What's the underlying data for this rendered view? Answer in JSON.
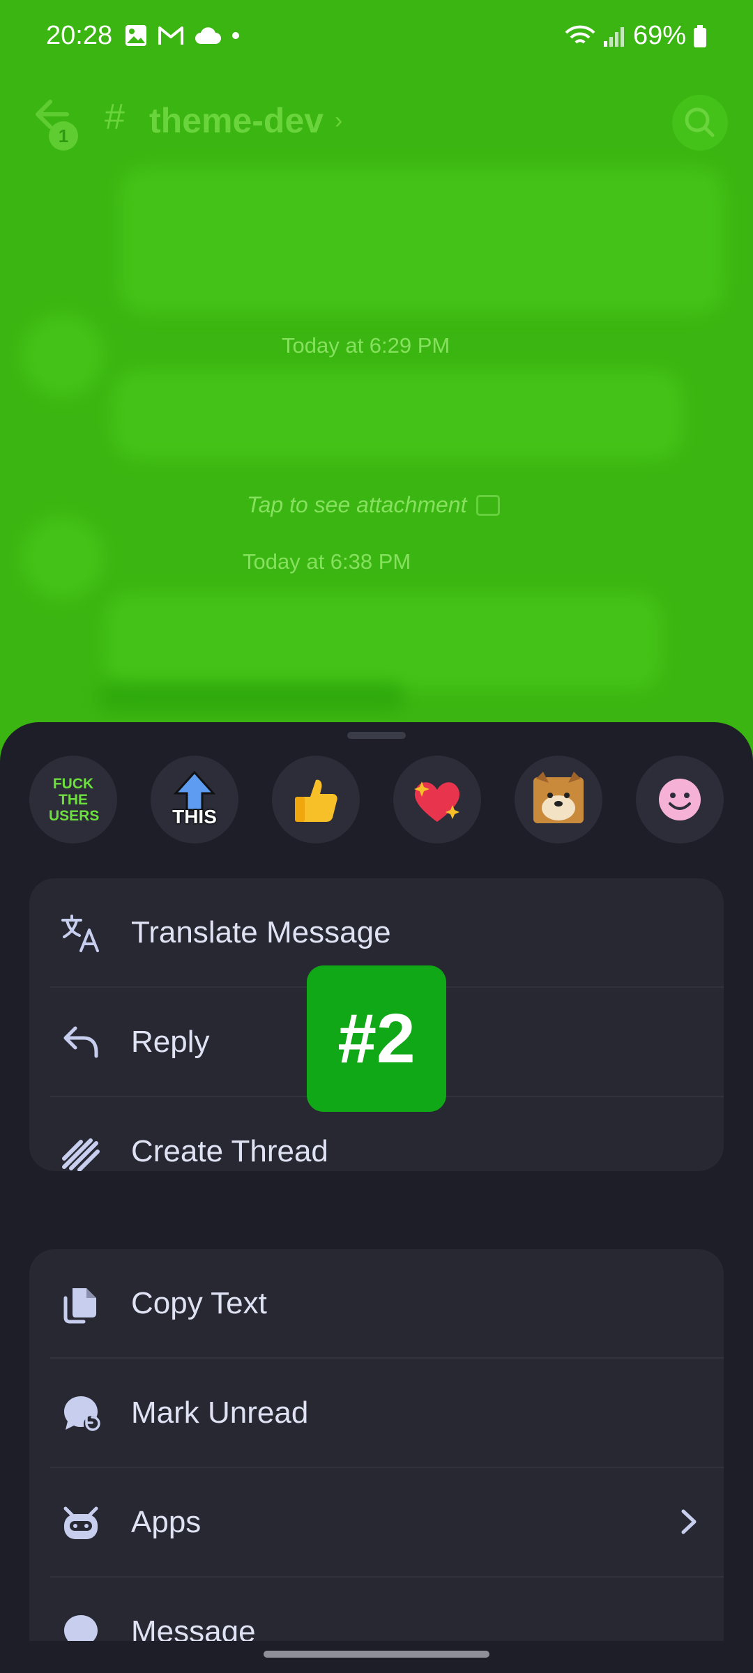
{
  "status_bar": {
    "time": "20:28",
    "battery": "69%"
  },
  "header": {
    "channel_name": "theme-dev",
    "notification_count": "1"
  },
  "chat": {
    "timestamp_1": "Today at 6:29 PM",
    "attachment_text": "Tap to see attachment",
    "timestamp_2": "Today at 6:38 PM"
  },
  "reactions": [
    {
      "name": "fuck-the-users-emoji",
      "text": "FUCK THE USERS"
    },
    {
      "name": "this-arrow-emoji",
      "text": "THIS"
    },
    {
      "name": "thumbs-up-emoji"
    },
    {
      "name": "sparkling-heart-emoji"
    },
    {
      "name": "doge-emoji"
    },
    {
      "name": "add-reaction-emoji"
    }
  ],
  "menu_primary": [
    {
      "label": "Translate Message",
      "icon": "translate-icon"
    },
    {
      "label": "Reply",
      "icon": "reply-icon"
    },
    {
      "label": "Create Thread",
      "icon": "thread-icon"
    }
  ],
  "menu_secondary": [
    {
      "label": "Copy Text",
      "icon": "copy-icon"
    },
    {
      "label": "Mark Unread",
      "icon": "mark-unread-icon"
    },
    {
      "label": "Apps",
      "icon": "apps-icon"
    },
    {
      "label": "Message",
      "icon": "message-icon"
    }
  ],
  "overlay_label": "#2",
  "colors": {
    "theme_green": "#3bb511",
    "sheet_bg": "#1d1e27",
    "card_bg": "#272832",
    "icon_color": "#c8cfee",
    "overlay_green": "#10a817"
  }
}
